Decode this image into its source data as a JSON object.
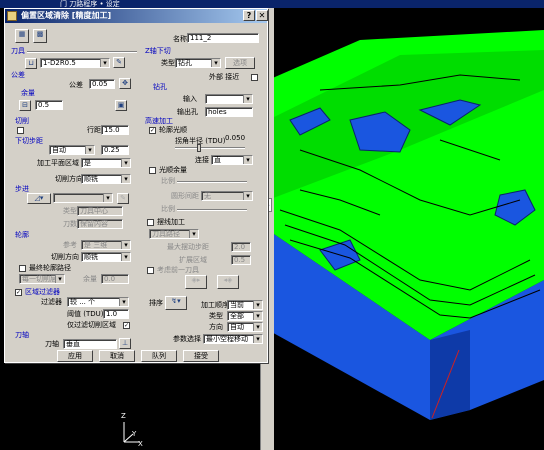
{
  "title_bar": {
    "title": "偏置区域清除 [精度加工]",
    "help": "?",
    "close": "✕"
  },
  "top_strip": {
    "text": "门 刀路程序 • 设定"
  },
  "name": {
    "label": "名称",
    "value": "111_2"
  },
  "tool": {
    "group": "刀具",
    "value": "1-D2R0.5"
  },
  "tolerance": {
    "group": "公差",
    "label": "公差",
    "value": "0.05"
  },
  "allowance": {
    "group": "余量",
    "value": "0.5"
  },
  "stepover": {
    "group": "切削",
    "row_label": "行距",
    "value": "15.0"
  },
  "stepdown": {
    "group": "下切步距",
    "mode": "自动",
    "value": "0.25",
    "level_label": "加工平面区域",
    "level_value": "是",
    "dir_label": "切削方向",
    "dir_value": "顺铣"
  },
  "pattern": {
    "group": "步进",
    "mode_label": "类型",
    "mode_value": "刀具中心",
    "rev_label": "刀数",
    "rev_value": "保留内容"
  },
  "profile": {
    "group": "轮廓",
    "a_label": "参考",
    "a_value": "是 三维",
    "dir_label": "切削方向",
    "dir_value": "顺铣",
    "final_label": "最终轮廓路径",
    "each_label": "每一切削层",
    "tol_label": "余量",
    "tol_value": "0.0"
  },
  "filter": {
    "group": "区域过滤器",
    "label": "过滤器",
    "value": "较 ... 个",
    "thresh_label": "阈值 (TDU)",
    "thresh_value": "1.0",
    "only_label": "仅过滤切削区域"
  },
  "toolaxis": {
    "group": "刀轴",
    "label": "刀轴",
    "value": "垂直"
  },
  "plunge": {
    "group": "Z轴下切",
    "type_label": "类型",
    "type_value": "钻孔",
    "extra": "选项",
    "out_label": "外部 接近"
  },
  "drill": {
    "group": "钻孔",
    "in_label": "输入",
    "out_label": "输出孔",
    "out_value": "holes"
  },
  "hsm": {
    "group": "高速加工",
    "smooth_label": "轮廓光顺",
    "radius_label": "拐角半径 (TDU)",
    "radius_value": "0.050",
    "conn_label": "连接",
    "conn_value": "直",
    "corner_label": "光顺余量",
    "ax_label": "比例",
    "ax_b": "圆形间距",
    "ax_b_value": "无",
    "ax_c": "比例"
  },
  "trochoid": {
    "label": "摆线加工",
    "type": "刀具路径",
    "dist_label": "最大摆动步距",
    "dist_value": "2.0",
    "expand_label": "扩展区域",
    "expand_value": "0.5",
    "keep_label": "考虑前一刀具"
  },
  "order": {
    "label": "排序",
    "area_label": "加工顺序",
    "area_value": "当前",
    "type_label": "类型",
    "type_value": "全部",
    "dir_label": "方向",
    "dir_value": "自动",
    "link_label": "参数选择",
    "link_value": "最小空程移动"
  },
  "buttons": {
    "apply": "应用",
    "cancel": "取消",
    "queue": "队列",
    "accept": "接受"
  },
  "axis": {
    "z": "Z",
    "y": "Y",
    "x": "X"
  },
  "colors": {
    "green": "#00ff00",
    "blue": "#1a56e0",
    "dark": "#0a246a"
  }
}
